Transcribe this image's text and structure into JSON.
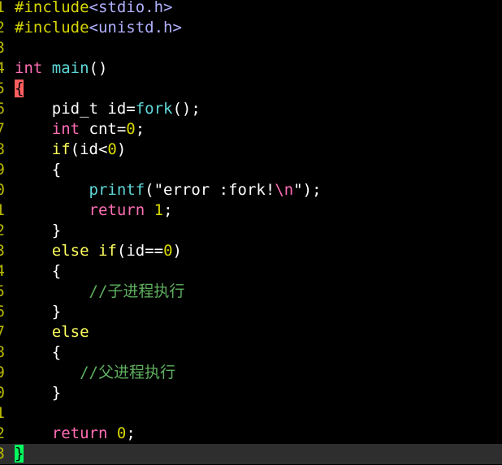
{
  "editor": {
    "colors": {
      "background": "#000000",
      "cursorline": "#2e2e2e",
      "line_number": "#b8b800",
      "preproc": "#d7d700",
      "include_target": "#b0b0ff",
      "type": "#ff6eb4",
      "function": "#5fd7d7",
      "plain": "#ffffff",
      "number": "#d7d700",
      "string": "#ffffff",
      "escape": "#ff6eb4",
      "comment": "#5faf5f",
      "statement": "#ffff5f",
      "match_paren": "#ff5f5f",
      "cursor": "#00ff5f"
    },
    "lines": [
      {
        "num": "1",
        "tokens": [
          {
            "text": "#include",
            "color": "#d7d700"
          },
          {
            "text": "<stdio.h>",
            "color": "#b0b0ff"
          }
        ]
      },
      {
        "num": "2",
        "tokens": [
          {
            "text": "#include",
            "color": "#d7d700"
          },
          {
            "text": "<unistd.h>",
            "color": "#b0b0ff"
          }
        ]
      },
      {
        "num": "3",
        "tokens": []
      },
      {
        "num": "4",
        "tokens": [
          {
            "text": "int",
            "color": "#ff6eb4"
          },
          {
            "text": " ",
            "color": "#ffffff"
          },
          {
            "text": "main",
            "color": "#5fd7d7"
          },
          {
            "text": "()",
            "color": "#ffffff"
          }
        ]
      },
      {
        "num": "5",
        "tokens": [
          {
            "text": "{",
            "color": "#000000",
            "hl": "red"
          }
        ]
      },
      {
        "num": "6",
        "tokens": [
          {
            "text": "    pid_t id=",
            "color": "#ffffff"
          },
          {
            "text": "fork",
            "color": "#5fd7d7"
          },
          {
            "text": "();",
            "color": "#ffffff"
          }
        ]
      },
      {
        "num": "7",
        "tokens": [
          {
            "text": "    ",
            "color": "#ffffff"
          },
          {
            "text": "int",
            "color": "#ff6eb4"
          },
          {
            "text": " cnt=",
            "color": "#ffffff"
          },
          {
            "text": "0",
            "color": "#d7d700"
          },
          {
            "text": ";",
            "color": "#ffffff"
          }
        ]
      },
      {
        "num": "8",
        "tokens": [
          {
            "text": "    ",
            "color": "#ffffff"
          },
          {
            "text": "if",
            "color": "#ffff5f"
          },
          {
            "text": "(id<",
            "color": "#ffffff"
          },
          {
            "text": "0",
            "color": "#d7d700"
          },
          {
            "text": ")",
            "color": "#ffffff"
          }
        ]
      },
      {
        "num": "9",
        "tokens": [
          {
            "text": "    {",
            "color": "#ffffff"
          }
        ]
      },
      {
        "num": "0",
        "tokens": [
          {
            "text": "        ",
            "color": "#ffffff"
          },
          {
            "text": "printf",
            "color": "#5fd7d7"
          },
          {
            "text": "(\"error :fork!",
            "color": "#ffffff"
          },
          {
            "text": "\\n",
            "color": "#ff6eb4"
          },
          {
            "text": "\");",
            "color": "#ffffff"
          }
        ]
      },
      {
        "num": "1",
        "tokens": [
          {
            "text": "        ",
            "color": "#ffffff"
          },
          {
            "text": "return",
            "color": "#ff6eb4"
          },
          {
            "text": " ",
            "color": "#ffffff"
          },
          {
            "text": "1",
            "color": "#d7d700"
          },
          {
            "text": ";",
            "color": "#ffffff"
          }
        ]
      },
      {
        "num": "2",
        "tokens": [
          {
            "text": "    }",
            "color": "#ffffff"
          }
        ]
      },
      {
        "num": "3",
        "tokens": [
          {
            "text": "    ",
            "color": "#ffffff"
          },
          {
            "text": "else",
            "color": "#ffff5f"
          },
          {
            "text": " ",
            "color": "#ffffff"
          },
          {
            "text": "if",
            "color": "#ffff5f"
          },
          {
            "text": "(id==",
            "color": "#ffffff"
          },
          {
            "text": "0",
            "color": "#d7d700"
          },
          {
            "text": ")",
            "color": "#ffffff"
          }
        ]
      },
      {
        "num": "4",
        "tokens": [
          {
            "text": "    {",
            "color": "#ffffff"
          }
        ]
      },
      {
        "num": "5",
        "tokens": [
          {
            "text": "        ",
            "color": "#ffffff"
          },
          {
            "text": "//子进程执行",
            "color": "#5faf5f"
          }
        ]
      },
      {
        "num": "6",
        "tokens": [
          {
            "text": "    }",
            "color": "#ffffff"
          }
        ]
      },
      {
        "num": "7",
        "tokens": [
          {
            "text": "    ",
            "color": "#ffffff"
          },
          {
            "text": "else",
            "color": "#ffff5f"
          }
        ]
      },
      {
        "num": "8",
        "tokens": [
          {
            "text": "    {",
            "color": "#ffffff"
          }
        ]
      },
      {
        "num": "9",
        "tokens": [
          {
            "text": "       ",
            "color": "#ffffff"
          },
          {
            "text": "//父进程执行",
            "color": "#5faf5f"
          }
        ]
      },
      {
        "num": "0",
        "tokens": [
          {
            "text": "    }",
            "color": "#ffffff"
          }
        ]
      },
      {
        "num": "1",
        "tokens": []
      },
      {
        "num": "2",
        "tokens": [
          {
            "text": "    ",
            "color": "#ffffff"
          },
          {
            "text": "return",
            "color": "#ff6eb4"
          },
          {
            "text": " ",
            "color": "#ffffff"
          },
          {
            "text": "0",
            "color": "#d7d700"
          },
          {
            "text": ";",
            "color": "#ffffff"
          }
        ]
      },
      {
        "num": "3",
        "tokens": [
          {
            "text": "}",
            "color": "#000000",
            "hl": "green"
          }
        ],
        "cursorline": true
      }
    ]
  }
}
